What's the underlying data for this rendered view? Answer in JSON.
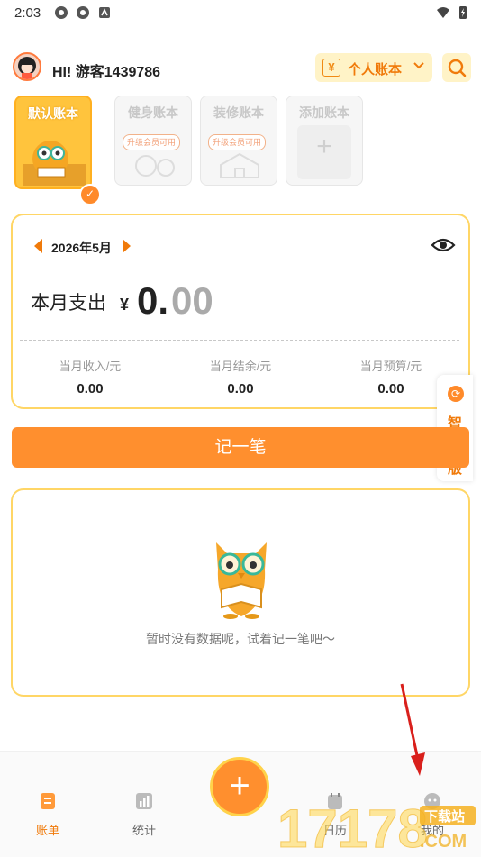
{
  "status_bar": {
    "time": "2:03"
  },
  "header": {
    "greeting": "HI! 游客1439786",
    "account_type": "个人账本",
    "account_icon": "¥"
  },
  "books": [
    {
      "label": "默认账本",
      "selected": true
    },
    {
      "label": "健身账本",
      "tag": "升级会员可用"
    },
    {
      "label": "装修账本",
      "tag": "升级会员可用"
    },
    {
      "label": "添加账本",
      "icon": "+"
    }
  ],
  "summary": {
    "month": "2026年5月",
    "expense_label": "本月支出",
    "currency": "¥",
    "amount_int": "0.",
    "amount_dec": "00",
    "stats": [
      {
        "label": "当月收入/元",
        "value": "0.00"
      },
      {
        "label": "当月结余/元",
        "value": "0.00"
      },
      {
        "label": "当月预算/元",
        "value": "0.00"
      }
    ]
  },
  "smart_tab": {
    "label": "智能版"
  },
  "record_button": {
    "label": "记一笔"
  },
  "empty_state": {
    "text": "暂时没有数据呢，试着记一笔吧～"
  },
  "nav": {
    "items": [
      {
        "label": "账单",
        "active": true
      },
      {
        "label": "统计"
      },
      {
        "label": "日历"
      },
      {
        "label": "我的"
      }
    ],
    "fab_icon": "+"
  },
  "watermark": {
    "brand": "17178",
    "tag": "下载站",
    "domain": ".COM"
  },
  "colors": {
    "accent": "#ff8f2e",
    "border": "#ffd666",
    "active_nav": "#f07a0a"
  }
}
